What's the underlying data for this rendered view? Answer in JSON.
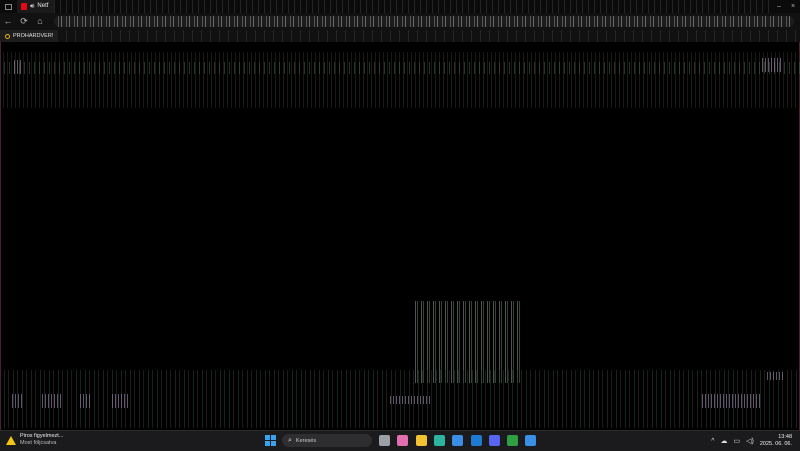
{
  "browser": {
    "tab": {
      "title": "Netf",
      "favicon_color": "#e50914",
      "audio_icon": "speaker-icon"
    },
    "window_controls": {
      "minimize": "–",
      "close": "×"
    },
    "nav": {
      "back": "←",
      "reload": "⟳",
      "home": "⌂"
    },
    "bookmark": {
      "label": "PROHARDVER!"
    }
  },
  "taskbar": {
    "weather": {
      "title": "Piros figyelmezt...",
      "subtitle": "Most följcsatva"
    },
    "search": {
      "label": "Keresés",
      "icon": "search-icon"
    },
    "start_color": "#3aa0f0",
    "apps": [
      {
        "name": "task-view",
        "color": "#9aa0a6"
      },
      {
        "name": "copilot",
        "color": "#e26fb0"
      },
      {
        "name": "file-explorer",
        "color": "#f2c230"
      },
      {
        "name": "edge",
        "color": "#2bb5a0"
      },
      {
        "name": "store",
        "color": "#3a8ee6"
      },
      {
        "name": "outlook",
        "color": "#1f7ad1"
      },
      {
        "name": "discord",
        "color": "#5865f2"
      },
      {
        "name": "xbox",
        "color": "#2ea043"
      },
      {
        "name": "media-player",
        "color": "#3a8ee6"
      }
    ],
    "tray": {
      "chevron": "^",
      "cloud": "☁",
      "monitor": "▭",
      "speaker": "◁)"
    },
    "clock": {
      "time": "13:48",
      "date": "2025. 06. 06."
    }
  }
}
